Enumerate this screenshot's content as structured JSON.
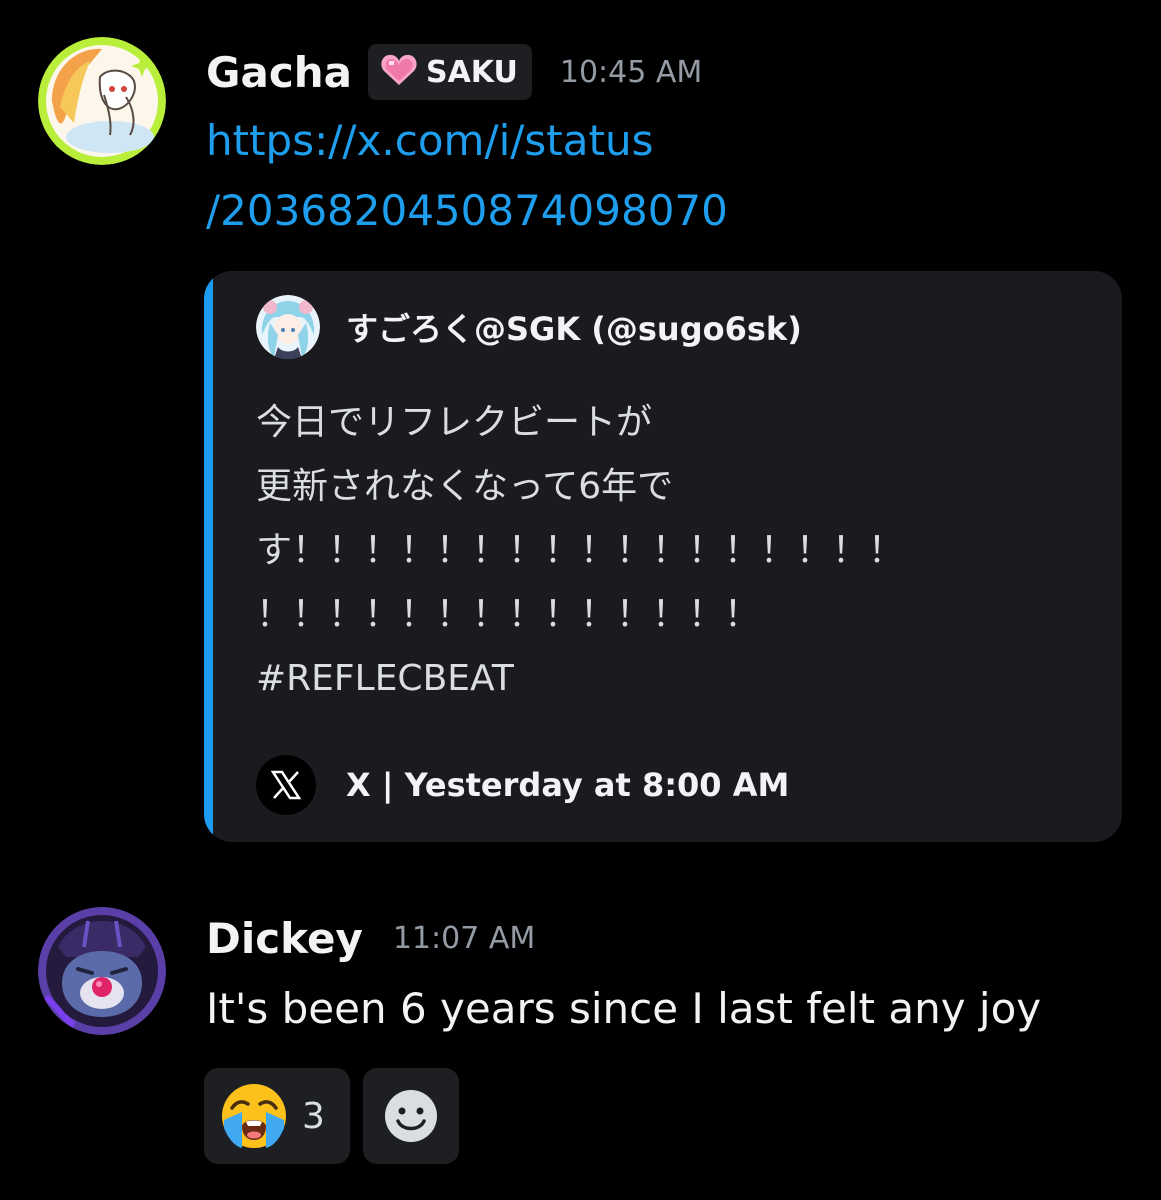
{
  "messages": [
    {
      "author": "Gacha",
      "role_tag": {
        "icon": "pink-heart-icon",
        "label": "SAKU"
      },
      "timestamp": "10:45 AM",
      "link": {
        "line1": "https://x.com/i/status",
        "line2": "/2036820450874098070"
      },
      "embed": {
        "accent_color": "#1d9bf0",
        "author": "すごろく@SGK (@sugo6sk)",
        "description": "今日でリフレクビートが\n更新されなくなって6年で\nす！！！！！！！！！！！！！！！！！\n！！！！！！！！！！！！！！\n#REFLECBEAT",
        "footer": "X | Yesterday at 8:00 AM",
        "footer_icon": "x-logo-icon"
      }
    },
    {
      "author": "Dickey",
      "timestamp": "11:07 AM",
      "text": "It's been 6 years since I last felt any joy",
      "reactions": [
        {
          "emoji": "loudly-crying-face-icon",
          "count": "3"
        },
        {
          "emoji": "add-reaction-smiley-icon"
        }
      ]
    }
  ],
  "colors": {
    "background": "#000000",
    "link": "#1e9eed",
    "username": "#f2f3f5",
    "timestamp": "#949ba4",
    "embed_bg": "#1b1b1f"
  }
}
